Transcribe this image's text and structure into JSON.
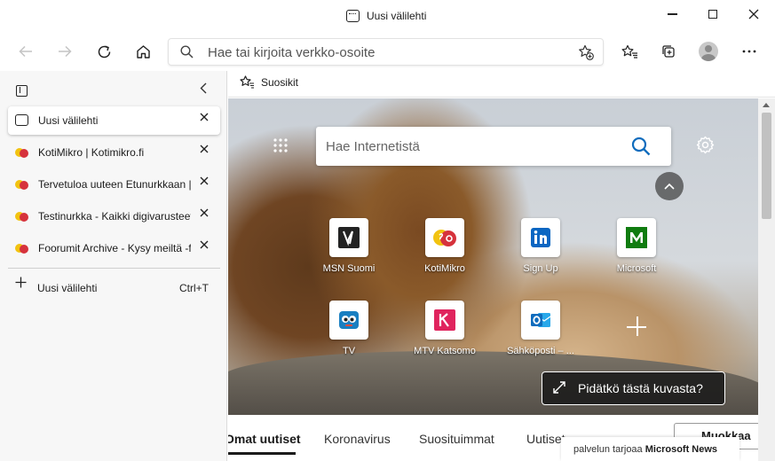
{
  "window": {
    "title": "Uusi välilehti"
  },
  "toolbar": {
    "address_placeholder": "Hae tai kirjoita verkko-osoite"
  },
  "sidebar": {
    "tabs": [
      {
        "label": "Uusi välilehti",
        "active": true,
        "icon": "new-tab-icon"
      },
      {
        "label": "KotiMikro | Kotimikro.fi",
        "active": false,
        "icon": "kotimikro-favicon"
      },
      {
        "label": "Tervetuloa uuteen Etunurkkaan | Kotimikro.fi",
        "active": false,
        "icon": "kotimikro-favicon"
      },
      {
        "label": "Testinurkka - Kaikki digivarusteet",
        "active": false,
        "icon": "kotimikro-favicon"
      },
      {
        "label": "Foorumit Archive - Kysy meiltä -foorumi",
        "active": false,
        "icon": "kotimikro-favicon"
      }
    ],
    "new_tab": {
      "label": "Uusi välilehti",
      "shortcut": "Ctrl+T"
    }
  },
  "favorites_bar": {
    "label": "Suosikit"
  },
  "newtab_page": {
    "search_placeholder": "Hae Internetistä",
    "quick_links": [
      {
        "name": "MSN Suomi",
        "icon": "msn-icon"
      },
      {
        "name": "KotiMikro",
        "icon": "kotimikro-icon"
      },
      {
        "name": "Sign Up",
        "icon": "linkedin-icon"
      },
      {
        "name": "Microsoft",
        "icon": "microsoft-icon"
      },
      {
        "name": "TV",
        "icon": "tv-icon"
      },
      {
        "name": "MTV Katsomo",
        "icon": "katsomo-icon"
      },
      {
        "name": "Sähköposti – ...",
        "icon": "outlook-icon"
      }
    ],
    "about_image": "Pidätkö tästä kuvasta?",
    "news_tabs": [
      "Omat uutiset",
      "Koronavirus",
      "Suosituimmat",
      "Uutiset"
    ],
    "customize_label": "Muokkaa",
    "provider_prefix": "palvelun tarjoaa",
    "provider_name": "Microsoft News"
  },
  "colors": {
    "linkedin": "#0a66c2",
    "microsoft": "#107c10",
    "katsomo": "#e0245e",
    "outlook": "#0f6cbd",
    "search_accent": "#0f6cbd"
  }
}
